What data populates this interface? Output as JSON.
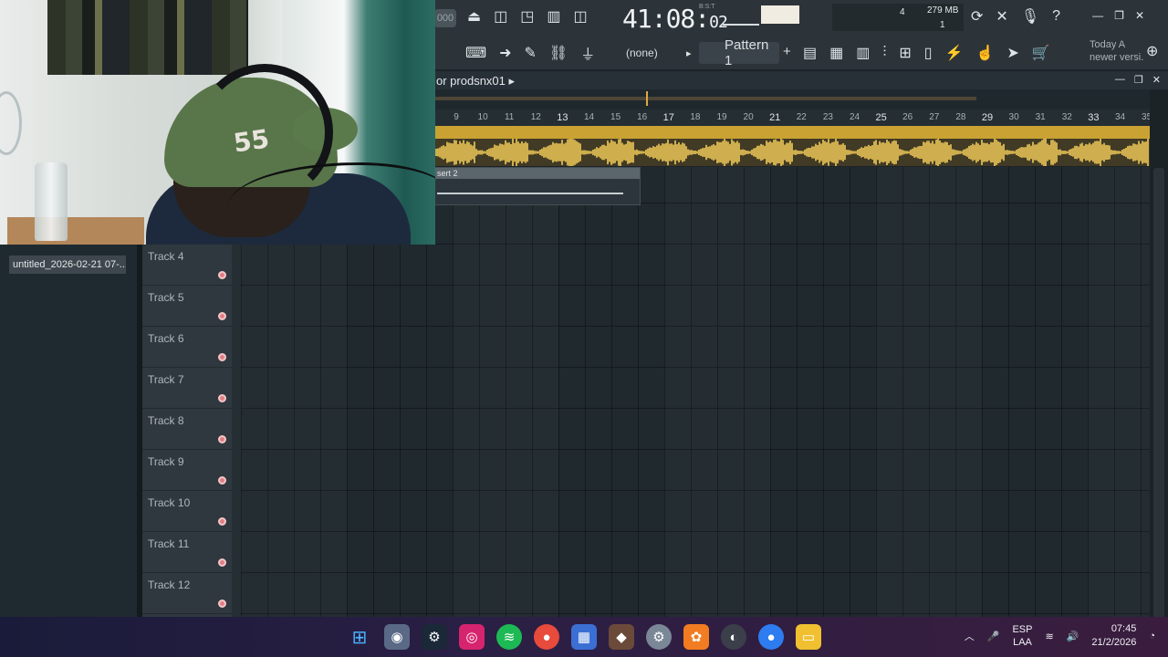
{
  "toolbar": {
    "tempo_partial": "000",
    "time_main": "41:08:",
    "time_small": "02",
    "time_label": "B:S:T",
    "cpu_top": "4",
    "cpu_bottom": "1",
    "memory": "279 MB",
    "pattern": "Pattern 1",
    "pattern_add": "+",
    "none_selector": "(none)",
    "news_line1": "Today  A",
    "news_line2": "newer versi."
  },
  "playlist": {
    "title": "or prodsnx01",
    "ruler": [
      "9",
      "10",
      "11",
      "12",
      "13",
      "14",
      "15",
      "16",
      "17",
      "18",
      "19",
      "20",
      "21",
      "22",
      "23",
      "24",
      "25",
      "26",
      "27",
      "28",
      "29",
      "30",
      "31",
      "32",
      "33",
      "34",
      "35"
    ],
    "insert_clip_label": "sert 2"
  },
  "browser": {
    "items": [
      "untitled_2026-02-21 07-..."
    ]
  },
  "tracks": [
    "Track 4",
    "Track 5",
    "Track 6",
    "Track 7",
    "Track 8",
    "Track 9",
    "Track 10",
    "Track 11",
    "Track 12"
  ],
  "taskbar": {
    "lang_top": "ESP",
    "lang_bottom": "LAA",
    "time": "07:45",
    "date": "21/2/2026"
  },
  "webcam": {
    "cap_text": "55"
  },
  "colors": {
    "audio_clip": "#c9a233",
    "waveform": "#f2cc58",
    "track_dot": "#e07f85",
    "background": "#1b2328"
  }
}
